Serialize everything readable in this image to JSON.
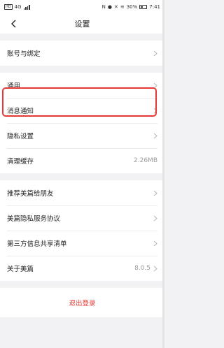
{
  "status_bar": {
    "carrier": "HD",
    "network": "4G",
    "battery_pct": "30%",
    "time": "7:41"
  },
  "header": {
    "title": "设置"
  },
  "sections": [
    [
      {
        "label": "账号与绑定",
        "value": ""
      }
    ],
    [
      {
        "label": "通用",
        "value": ""
      },
      {
        "label": "消息通知",
        "value": ""
      },
      {
        "label": "隐私设置",
        "value": ""
      },
      {
        "label": "清理缓存",
        "value": "2.26MB"
      }
    ],
    [
      {
        "label": "推荐美篇给朋友",
        "value": ""
      },
      {
        "label": "美篇隐私服务协议",
        "value": ""
      },
      {
        "label": "第三方信息共享清单",
        "value": ""
      },
      {
        "label": "关于美篇",
        "value": "8.0.5"
      }
    ]
  ],
  "logout_label": "退出登录",
  "colors": {
    "accent": "#e53935",
    "background": "#f2f2f4"
  }
}
